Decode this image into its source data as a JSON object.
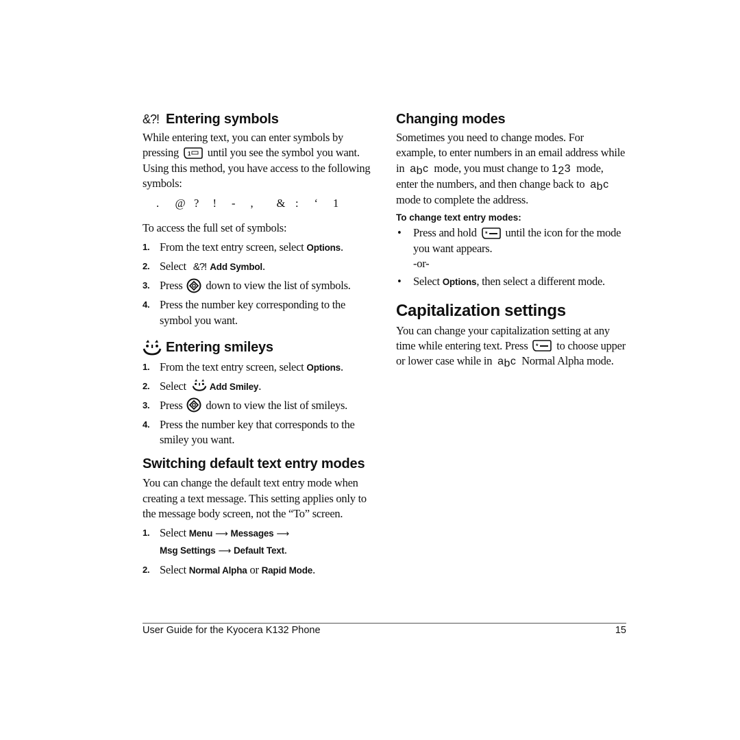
{
  "left_column": {
    "entering_symbols": {
      "icon_glyph": "&?!",
      "heading": "Entering symbols",
      "intro_part1": "While entering text, you can enter symbols by pressing",
      "key_icon": "1-key-icon",
      "intro_part2": "until you see the symbol you want. Using this method, you have access to the following symbols:",
      "symbols": [
        ".",
        "@",
        "?",
        "!",
        "-",
        ",",
        "&",
        ":",
        "‘",
        "1"
      ],
      "access_text": "To access the full set of symbols:",
      "steps": [
        {
          "num": "1.",
          "text": "From the text entry screen, select ",
          "bold": "Options",
          "after": "."
        },
        {
          "num": "2.",
          "text": "Select ",
          "icon_glyph": "&?!",
          "bold": "Add Symbol",
          "after": "."
        },
        {
          "num": "3.",
          "text_before": "Press",
          "icon": "navigation-key-icon",
          "text_after": "down to view the list of symbols."
        },
        {
          "num": "4.",
          "text": "Press the number key corresponding to the symbol you want."
        }
      ]
    },
    "entering_smileys": {
      "icon": "smiley-icon",
      "heading": "Entering smileys",
      "steps": [
        {
          "num": "1.",
          "text": "From the text entry screen, select ",
          "bold": "Options",
          "after": "."
        },
        {
          "num": "2.",
          "text": "Select ",
          "bold": "Add Smiley",
          "after": "."
        },
        {
          "num": "3.",
          "text_before": "Press",
          "icon": "navigation-key-icon",
          "text_after": "down to view the list of smileys."
        },
        {
          "num": "4.",
          "text": "Press the number key that corresponds to the smiley you want."
        }
      ]
    },
    "switching_modes": {
      "heading": "Switching default text entry modes",
      "body": "You can change the default text entry mode when creating a text message. This setting applies only to the message body screen, not the “To” screen.",
      "steps": [
        {
          "num": "1.",
          "text": "Select ",
          "path": [
            "Menu",
            "Messages",
            "Msg Settings",
            "Default Text"
          ],
          "after": "."
        },
        {
          "num": "2.",
          "text": "Select ",
          "bold1": "Normal Alpha",
          "or": " or ",
          "bold2": "Rapid Mode",
          "after": "."
        }
      ],
      "arrow": "⟶"
    }
  },
  "right_column": {
    "changing_modes": {
      "heading": "Changing modes",
      "body_p1": "Sometimes you need to change modes. For example, to enter numbers in an email address while in",
      "abc_glyph": {
        "a": "a",
        "b": "b",
        "c": "c"
      },
      "body_p2": "mode, you must change to",
      "num_glyph": {
        "a": "1",
        "b": "2",
        "c": "3"
      },
      "body_p3": "mode, enter the numbers, and then change back to",
      "body_p4": "mode to complete the address.",
      "subheading": "To change text entry modes:",
      "bullets": [
        {
          "text_before": "Press and hold",
          "icon": "star-shift-key-icon",
          "text_after": "until the icon for the mode you want appears.",
          "or": "-or-"
        },
        {
          "text_before": "Select ",
          "bold": "Options",
          "text_after": ", then select a different mode."
        }
      ]
    },
    "capitalization": {
      "heading": "Capitalization settings",
      "body_p1": "You can change your capitalization setting at any time while entering text. Press",
      "key_icon": "star-shift-key-icon",
      "body_p2": "to choose upper or lower case while in",
      "body_p3": "Normal Alpha mode."
    }
  },
  "footer": {
    "title": "User Guide for the Kyocera K132 Phone",
    "page_number": "15"
  },
  "bullet_char": "•"
}
